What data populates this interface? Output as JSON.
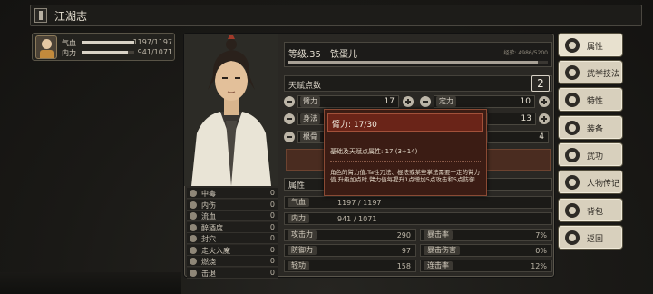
{
  "header": {
    "title": "江湖志"
  },
  "mini_card": {
    "hp_label": "气血",
    "hp_value": "1197/1197",
    "hp_fill": 1.0,
    "mp_label": "内力",
    "mp_value": "941/1071",
    "mp_fill": 0.88
  },
  "character": {
    "level_text": "等级.35",
    "name": "铁蛋儿",
    "exp_text": "经验: 4986/5200",
    "exp_fill": 0.96
  },
  "talent": {
    "label": "天赋点数",
    "value": "2"
  },
  "attributes": [
    {
      "name": "臂力",
      "value": "17"
    },
    {
      "name": "定力",
      "value": "10"
    },
    {
      "name": "身法",
      "value": ""
    },
    {
      "name": "",
      "value": "13"
    },
    {
      "name": "根骨",
      "value": ""
    },
    {
      "name": "",
      "value": "4"
    }
  ],
  "status_effects": [
    {
      "name": "中毒",
      "value": "0"
    },
    {
      "name": "内伤",
      "value": "0"
    },
    {
      "name": "流血",
      "value": "0"
    },
    {
      "name": "醉酒度",
      "value": "0"
    },
    {
      "name": "封穴",
      "value": "0"
    },
    {
      "name": "走火入魔",
      "value": "0"
    },
    {
      "name": "燃烧",
      "value": "0"
    },
    {
      "name": "击退",
      "value": "0"
    }
  ],
  "stats_section": {
    "title": "属性"
  },
  "hp_row": {
    "label": "气血",
    "value": "1197 / 1197"
  },
  "mp_row": {
    "label": "内力",
    "value": "941 / 1071"
  },
  "stats_left": [
    {
      "label": "攻击力",
      "value": "290"
    },
    {
      "label": "防御力",
      "value": "97"
    },
    {
      "label": "轻功",
      "value": "158"
    }
  ],
  "stats_right": [
    {
      "label": "暴击率",
      "value": "7%"
    },
    {
      "label": "暴击伤害",
      "value": "0%"
    },
    {
      "label": "连击率",
      "value": "12%"
    }
  ],
  "tooltip": {
    "title": "臂力: 17/30",
    "base": "基础及天赋点属性: 17 (3+14)",
    "desc": "角色的臂力值,Ta性刀法、棍法或某些掌法需要一定的臂力值,升级加点时,臂力值每提升1点增加5点攻击和5点防御"
  },
  "side_menu": [
    {
      "label": "属性",
      "icon": "person-attribute-icon"
    },
    {
      "label": "武学技法",
      "icon": "martial-skill-icon"
    },
    {
      "label": "特性",
      "icon": "trait-icon"
    },
    {
      "label": "装备",
      "icon": "sword-icon"
    },
    {
      "label": "武功",
      "icon": "book-icon"
    },
    {
      "label": "人物传记",
      "icon": "biography-icon"
    },
    {
      "label": "背包",
      "icon": "bag-icon"
    },
    {
      "label": "返回",
      "icon": "return-icon"
    }
  ],
  "colors": {
    "accent_red": "#6a2418",
    "panel": "#2a2824",
    "button": "#d8d0bd"
  }
}
